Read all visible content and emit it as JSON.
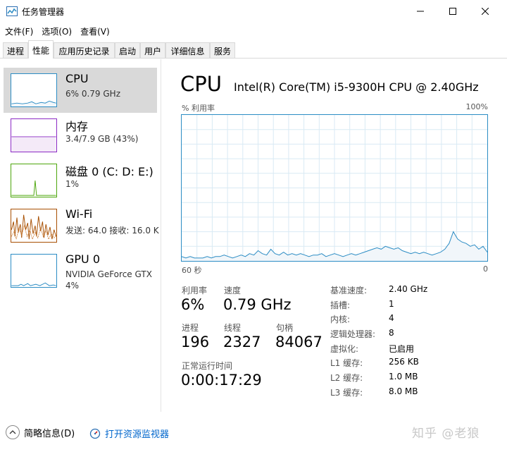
{
  "window": {
    "title": "任务管理器",
    "icon": "task-manager-icon"
  },
  "menu": [
    "文件(F)",
    "选项(O)",
    "查看(V)"
  ],
  "tabs": [
    "进程",
    "性能",
    "应用历史记录",
    "启动",
    "用户",
    "详细信息",
    "服务"
  ],
  "active_tab": "性能",
  "resources": [
    {
      "name": "CPU",
      "detail": "6% 0.79 GHz",
      "selected": true,
      "color": "#2b8cc4"
    },
    {
      "name": "内存",
      "detail": "3.4/7.9 GB (43%)",
      "selected": false,
      "color": "#8b2ac4"
    },
    {
      "name": "磁盘 0 (C: D: E:)",
      "detail": "1%",
      "selected": false,
      "color": "#4da60c"
    },
    {
      "name": "Wi-Fi",
      "detail": "发送: 64.0 接收: 16.0 K",
      "selected": false,
      "color": "#a74f01"
    },
    {
      "name": "GPU 0",
      "detail": "NVIDIA GeForce GTX",
      "detail2": "4%",
      "selected": false,
      "color": "#2b8cc4"
    }
  ],
  "cpu": {
    "title": "CPU",
    "model": "Intel(R) Core(TM) i5-9300H CPU @ 2.40GHz",
    "graph_label": "% 利用率",
    "graph_max": "100%",
    "axis_left": "60 秒",
    "axis_right": "0",
    "utilization_series": [
      3,
      2,
      3,
      2,
      2,
      2,
      3,
      2,
      3,
      3,
      4,
      3,
      2,
      3,
      4,
      3,
      5,
      4,
      7,
      5,
      4,
      8,
      5,
      4,
      6,
      4,
      5,
      4,
      5,
      4,
      3,
      4,
      4,
      5,
      3,
      4,
      5,
      4,
      3,
      4,
      5,
      4,
      5,
      6,
      7,
      8,
      9,
      8,
      10,
      9,
      8,
      9,
      7,
      6,
      5,
      6,
      5,
      6,
      5,
      4,
      5,
      6,
      8,
      12,
      20,
      15,
      13,
      12,
      10,
      11,
      8,
      10,
      6
    ],
    "stats": {
      "utilization_label": "利用率",
      "utilization": "6%",
      "speed_label": "速度",
      "speed": "0.79 GHz",
      "processes_label": "进程",
      "processes": "196",
      "threads_label": "线程",
      "threads": "2327",
      "handles_label": "句柄",
      "handles": "84067",
      "uptime_label": "正常运行时间",
      "uptime": "0:00:17:29"
    },
    "specs": [
      {
        "label": "基准速度:",
        "value": "2.40 GHz"
      },
      {
        "label": "插槽:",
        "value": "1"
      },
      {
        "label": "内核:",
        "value": "4"
      },
      {
        "label": "逻辑处理器:",
        "value": "8"
      },
      {
        "label": "虚拟化:",
        "value": "已启用"
      },
      {
        "label": "L1 缓存:",
        "value": "256 KB"
      },
      {
        "label": "L2 缓存:",
        "value": "1.0 MB"
      },
      {
        "label": "L3 缓存:",
        "value": "8.0 MB"
      }
    ]
  },
  "footer": {
    "fewer_details": "简略信息(D)",
    "open_resmon": "打开资源监视器"
  },
  "watermark": "知乎 @老狼"
}
